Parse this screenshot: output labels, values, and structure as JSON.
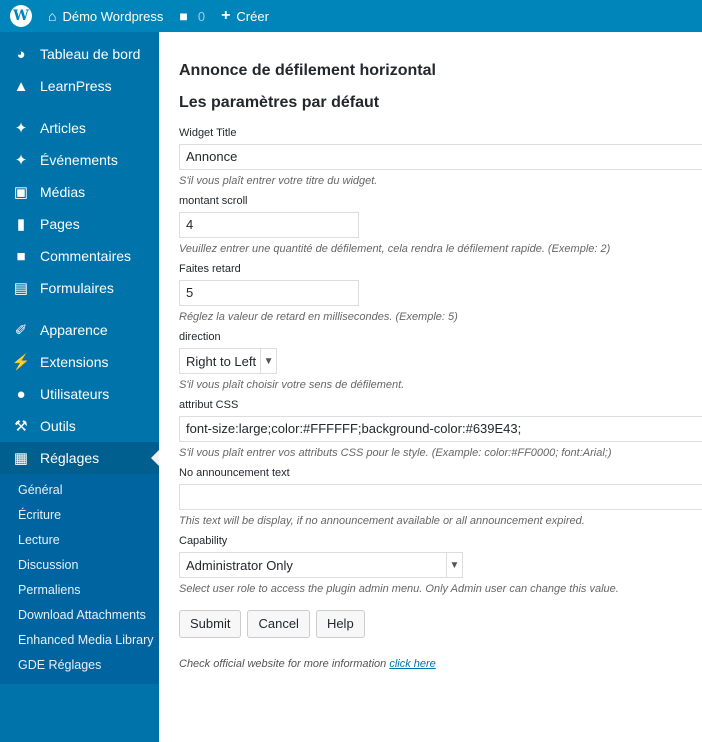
{
  "adminbar": {
    "site_name": "Démo Wordpress",
    "comment_count": "0",
    "new_label": "Créer"
  },
  "sidebar": {
    "items": [
      {
        "label": "Tableau de bord",
        "icon": "dashboard-icon"
      },
      {
        "label": "LearnPress",
        "icon": "graduation-cap-icon"
      },
      {
        "label": "Articles",
        "icon": "pushpin-icon"
      },
      {
        "label": "Événements",
        "icon": "pushpin-icon"
      },
      {
        "label": "Médias",
        "icon": "media-icon"
      },
      {
        "label": "Pages",
        "icon": "page-icon"
      },
      {
        "label": "Commentaires",
        "icon": "comment-icon"
      },
      {
        "label": "Formulaires",
        "icon": "form-icon"
      },
      {
        "label": "Apparence",
        "icon": "paintbrush-icon"
      },
      {
        "label": "Extensions",
        "icon": "plugin-icon"
      },
      {
        "label": "Utilisateurs",
        "icon": "users-icon"
      },
      {
        "label": "Outils",
        "icon": "wrench-icon"
      },
      {
        "label": "Réglages",
        "icon": "settings-icon"
      }
    ],
    "submenu": [
      "Général",
      "Écriture",
      "Lecture",
      "Discussion",
      "Permaliens",
      "Download Attachments",
      "Enhanced Media Library",
      "GDE Réglages"
    ]
  },
  "main": {
    "title": "Annonce de défilement horizontal",
    "subtitle": "Les paramètres par défaut",
    "fields": {
      "widget_title": {
        "label": "Widget Title",
        "value": "Annonce",
        "help": "S'il vous plaît entrer votre titre du widget."
      },
      "scroll_amount": {
        "label": "montant scroll",
        "value": "4",
        "help": "Veuillez entrer une quantité de défilement, cela rendra le défilement rapide. (Exemple: 2)"
      },
      "delay": {
        "label": "Faites retard",
        "value": "5",
        "help": "Réglez la valeur de retard en millisecondes. (Exemple: 5)"
      },
      "direction": {
        "label": "direction",
        "value": "Right to Left",
        "help": "S'il vous plaît choisir votre sens de défilement."
      },
      "css": {
        "label": "attribut CSS",
        "value": "font-size:large;color:#FFFFFF;background-color:#639E43;",
        "help": "S'il vous plaît entrer vos attributs CSS pour le style. (Example: color:#FF0000; font:Arial;)"
      },
      "no_announcement": {
        "label": "No announcement text",
        "value": "",
        "help": "This text will be display, if no announcement available or all announcement expired."
      },
      "capability": {
        "label": "Capability",
        "value": "Administrator Only",
        "help": "Select user role to access the plugin admin menu. Only Admin user can change this value."
      }
    },
    "buttons": {
      "submit": "Submit",
      "cancel": "Cancel",
      "help": "Help"
    },
    "footer": {
      "text": "Check official website for more information",
      "link": "click here"
    }
  },
  "colors": {
    "adminbar": "#0085ba",
    "sidebar": "#0073aa",
    "link": "#0073aa"
  }
}
